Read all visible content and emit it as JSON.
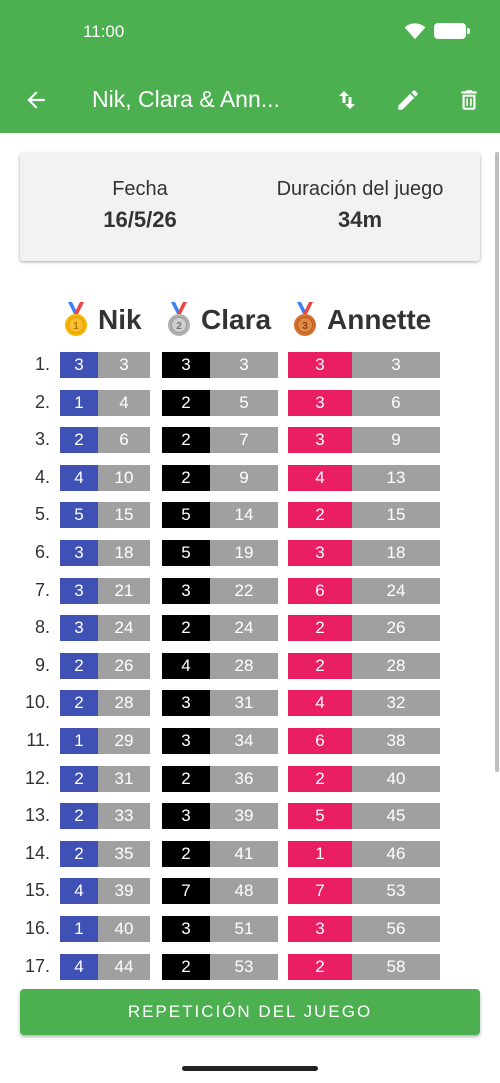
{
  "status_bar": {
    "time": "11:00"
  },
  "appbar": {
    "title": "Nik, Clara & Ann...",
    "icons": [
      "back-arrow-icon",
      "sort-icon",
      "edit-icon",
      "delete-icon"
    ]
  },
  "info": {
    "date_label": "Fecha",
    "date_value": "16/5/26",
    "duration_label": "Duración del juego",
    "duration_value": "34m"
  },
  "players": [
    {
      "name": "Nik",
      "medal": "gold-medal-icon",
      "color": "#3f51b5"
    },
    {
      "name": "Clara",
      "medal": "silver-medal-icon",
      "color": "#000000"
    },
    {
      "name": "Annette",
      "medal": "bronze-medal-icon",
      "color": "#e91e63"
    }
  ],
  "rounds": [
    {
      "n": "1.",
      "s1": "3",
      "t1": "3",
      "s2": "3",
      "t2": "3",
      "s3": "3",
      "t3": "3"
    },
    {
      "n": "2.",
      "s1": "1",
      "t1": "4",
      "s2": "2",
      "t2": "5",
      "s3": "3",
      "t3": "6"
    },
    {
      "n": "3.",
      "s1": "2",
      "t1": "6",
      "s2": "2",
      "t2": "7",
      "s3": "3",
      "t3": "9"
    },
    {
      "n": "4.",
      "s1": "4",
      "t1": "10",
      "s2": "2",
      "t2": "9",
      "s3": "4",
      "t3": "13"
    },
    {
      "n": "5.",
      "s1": "5",
      "t1": "15",
      "s2": "5",
      "t2": "14",
      "s3": "2",
      "t3": "15"
    },
    {
      "n": "6.",
      "s1": "3",
      "t1": "18",
      "s2": "5",
      "t2": "19",
      "s3": "3",
      "t3": "18"
    },
    {
      "n": "7.",
      "s1": "3",
      "t1": "21",
      "s2": "3",
      "t2": "22",
      "s3": "6",
      "t3": "24"
    },
    {
      "n": "8.",
      "s1": "3",
      "t1": "24",
      "s2": "2",
      "t2": "24",
      "s3": "2",
      "t3": "26"
    },
    {
      "n": "9.",
      "s1": "2",
      "t1": "26",
      "s2": "4",
      "t2": "28",
      "s3": "2",
      "t3": "28"
    },
    {
      "n": "10.",
      "s1": "2",
      "t1": "28",
      "s2": "3",
      "t2": "31",
      "s3": "4",
      "t3": "32"
    },
    {
      "n": "11.",
      "s1": "1",
      "t1": "29",
      "s2": "3",
      "t2": "34",
      "s3": "6",
      "t3": "38"
    },
    {
      "n": "12.",
      "s1": "2",
      "t1": "31",
      "s2": "2",
      "t2": "36",
      "s3": "2",
      "t3": "40"
    },
    {
      "n": "13.",
      "s1": "2",
      "t1": "33",
      "s2": "3",
      "t2": "39",
      "s3": "5",
      "t3": "45"
    },
    {
      "n": "14.",
      "s1": "2",
      "t1": "35",
      "s2": "2",
      "t2": "41",
      "s3": "1",
      "t3": "46"
    },
    {
      "n": "15.",
      "s1": "4",
      "t1": "39",
      "s2": "7",
      "t2": "48",
      "s3": "7",
      "t3": "53"
    },
    {
      "n": "16.",
      "s1": "1",
      "t1": "40",
      "s2": "3",
      "t2": "51",
      "s3": "3",
      "t3": "56"
    },
    {
      "n": "17.",
      "s1": "4",
      "t1": "44",
      "s2": "2",
      "t2": "53",
      "s3": "2",
      "t3": "58"
    }
  ],
  "replay_button": {
    "label": "REPETICIÓN DEL JUEGO"
  }
}
